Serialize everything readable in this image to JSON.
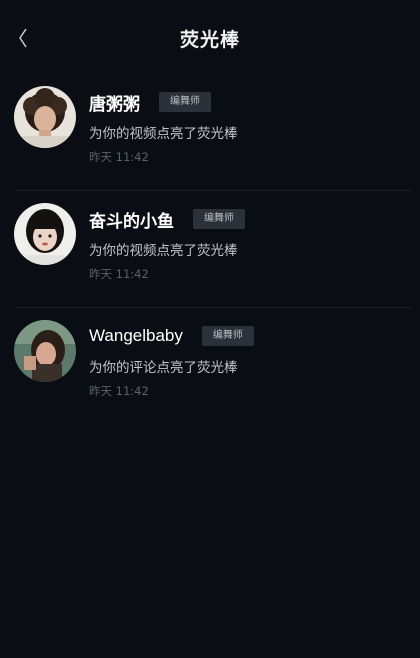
{
  "header": {
    "title": "荧光棒",
    "back_icon": "chevron-left-icon"
  },
  "notifications": [
    {
      "name": "唐粥粥",
      "badge": "编舞师",
      "action": "为你的视频点亮了荧光棒",
      "time": "昨天 11:42"
    },
    {
      "name": "奋斗的小鱼",
      "badge": "编舞师",
      "action": "为你的视频点亮了荧光棒",
      "time": "昨天 11:42"
    },
    {
      "name": "Wangelbaby",
      "badge": "编舞师",
      "action": "为你的评论点亮了荧光棒",
      "time": "昨天 11:42"
    }
  ],
  "colors": {
    "background": "#0a0e14",
    "badge_bg": "#2c3038",
    "secondary_text": "#c3c6cb",
    "time_text": "#5c616a"
  }
}
